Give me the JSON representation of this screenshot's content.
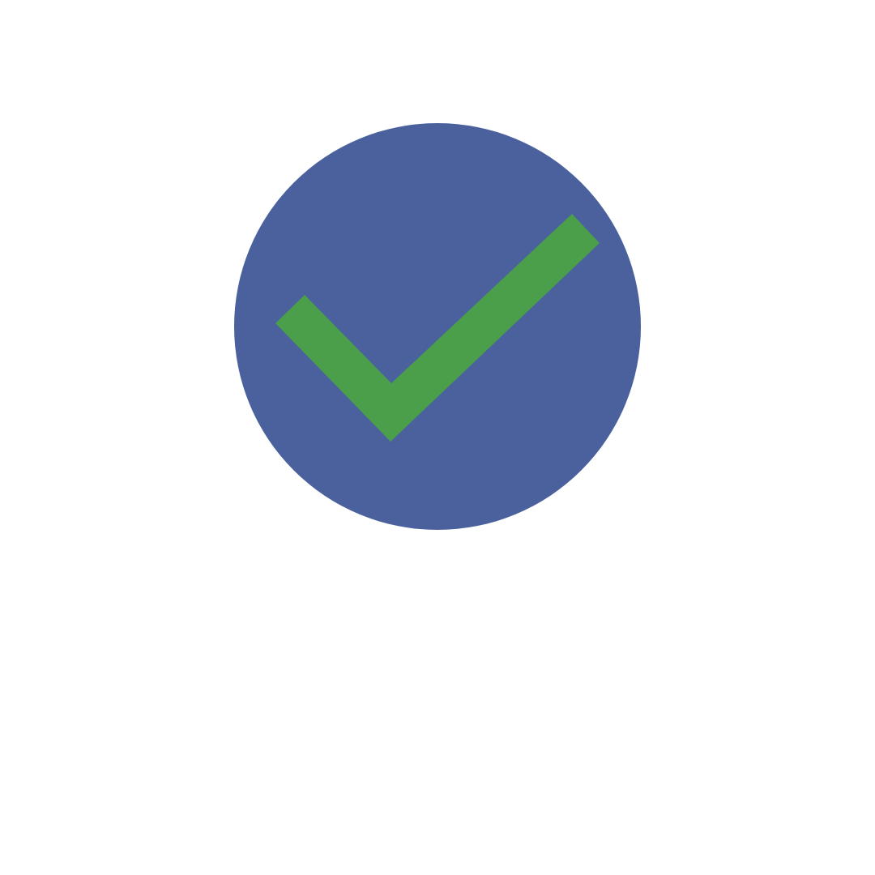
{
  "icon": {
    "name": "checkmark-circle-icon",
    "circle_color": "#4A619D",
    "check_color": "#4B9E4A",
    "background_color": "#FFFFFF"
  }
}
